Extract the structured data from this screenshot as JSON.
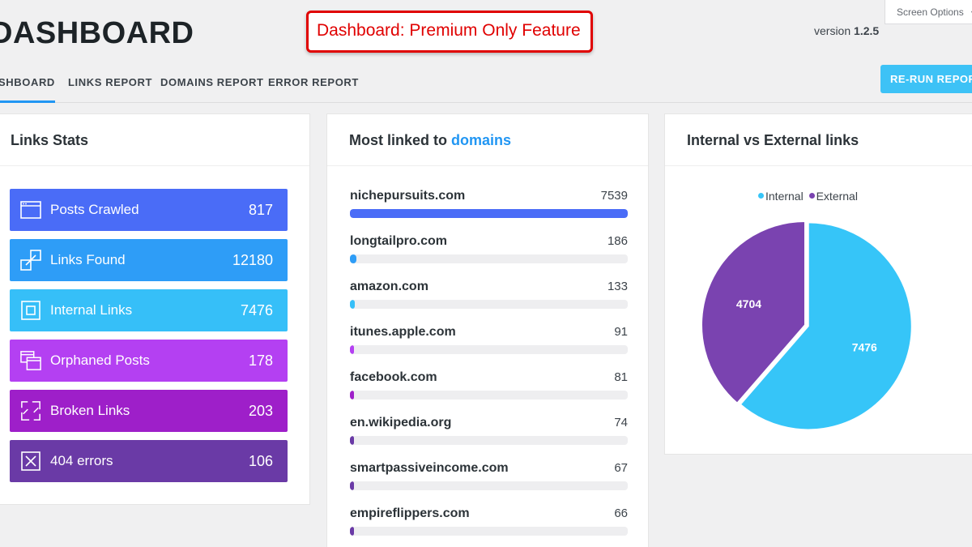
{
  "header": {
    "title": "DASHBOARD",
    "premium_notice": "Dashboard: Premium Only Feature",
    "version_label": "version",
    "version_number": "1.2.5",
    "screen_options": "Screen Options"
  },
  "tabs": [
    {
      "label": "SHBOARD",
      "active": true
    },
    {
      "label": "LINKS REPORT",
      "active": false
    },
    {
      "label": "DOMAINS REPORT",
      "active": false
    },
    {
      "label": "ERROR REPORT",
      "active": false
    }
  ],
  "rerun_label": "RE-RUN REPORTS",
  "links_stats": {
    "title": "Links Stats",
    "items": [
      {
        "label": "Posts Crawled",
        "value": "817",
        "icon": "browser-window-icon",
        "color": "#4a6cf7"
      },
      {
        "label": "Links Found",
        "value": "12180",
        "icon": "link-icon",
        "color": "#2e9df7"
      },
      {
        "label": "Internal Links",
        "value": "7476",
        "icon": "internal-box-icon",
        "color": "#36bff8"
      },
      {
        "label": "Orphaned Posts",
        "value": "178",
        "icon": "windows-icon",
        "color": "#b440f2"
      },
      {
        "label": "Broken Links",
        "value": "203",
        "icon": "broken-link-icon",
        "color": "#9e1fc9"
      },
      {
        "label": "404 errors",
        "value": "106",
        "icon": "close-box-icon",
        "color": "#6a3aa6"
      }
    ]
  },
  "domains": {
    "title_prefix": "Most linked to",
    "title_link": "domains",
    "rows": [
      {
        "name": "nichepursuits.com",
        "count": "7539",
        "value": 7539,
        "color": "#4a6cf7"
      },
      {
        "name": "longtailpro.com",
        "count": "186",
        "value": 186,
        "color": "#2e9df7"
      },
      {
        "name": "amazon.com",
        "count": "133",
        "value": 133,
        "color": "#36bff8"
      },
      {
        "name": "itunes.apple.com",
        "count": "91",
        "value": 91,
        "color": "#b440f2"
      },
      {
        "name": "facebook.com",
        "count": "81",
        "value": 81,
        "color": "#9e1fc9"
      },
      {
        "name": "en.wikipedia.org",
        "count": "74",
        "value": 74,
        "color": "#6a3aa6"
      },
      {
        "name": "smartpassiveincome.com",
        "count": "67",
        "value": 67,
        "color": "#6a3aa6"
      },
      {
        "name": "empireflippers.com",
        "count": "66",
        "value": 66,
        "color": "#6a3aa6"
      }
    ]
  },
  "internal_external": {
    "title": "Internal vs External links",
    "legend": [
      {
        "name": "Internal",
        "color": "#36c5f8"
      },
      {
        "name": "External",
        "color": "#7a43b0"
      }
    ]
  },
  "chart_data": {
    "type": "pie",
    "categories": [
      "Internal",
      "External"
    ],
    "values": [
      7476,
      4704
    ],
    "colors": [
      "#36c5f8",
      "#7a43b0"
    ],
    "legend_position": "top"
  }
}
